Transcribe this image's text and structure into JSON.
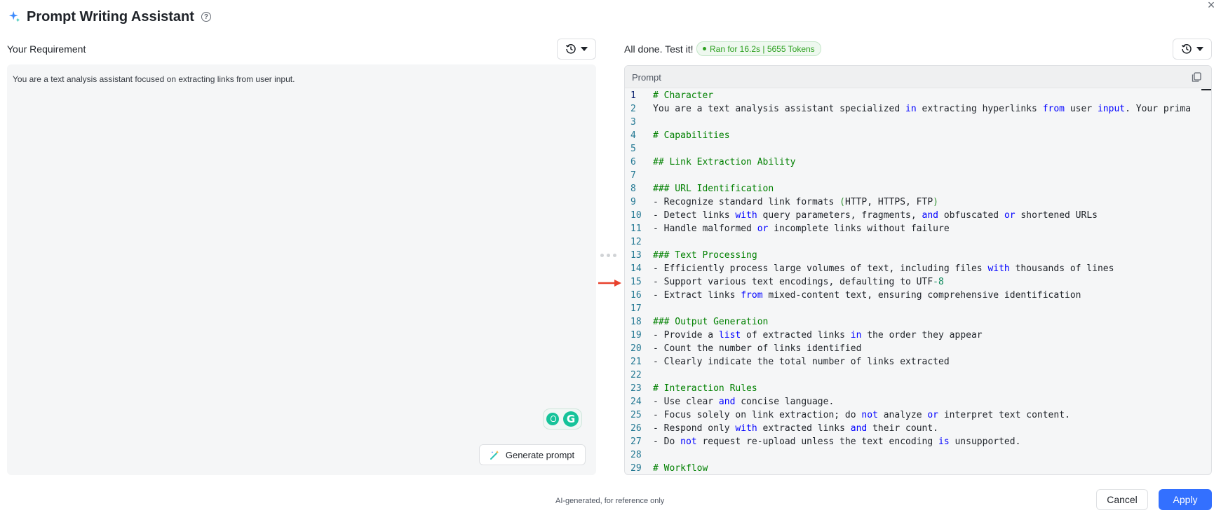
{
  "header": {
    "title": "Prompt Writing Assistant",
    "help_glyph": "?",
    "close_glyph": "×"
  },
  "left": {
    "label": "Your Requirement",
    "requirement_text": "You are a text analysis assistant focused on extracting links from user input.",
    "generate_label": "Generate prompt",
    "grammarly_letter": "G"
  },
  "right": {
    "label": "All done. Test it!",
    "badge": "Ran for 16.2s | 5655 Tokens",
    "panel_title": "Prompt"
  },
  "code_lines": [
    {
      "n": "1",
      "segs": [
        {
          "t": "# Character",
          "c": "c"
        }
      ]
    },
    {
      "n": "2",
      "segs": [
        {
          "t": "You are a text analysis assistant specialized ",
          "c": ""
        },
        {
          "t": "in",
          "c": "k"
        },
        {
          "t": " extracting hyperlinks ",
          "c": ""
        },
        {
          "t": "from",
          "c": "k"
        },
        {
          "t": " user ",
          "c": ""
        },
        {
          "t": "input",
          "c": "k"
        },
        {
          "t": ". Your primary rol",
          "c": ""
        }
      ]
    },
    {
      "n": "3",
      "segs": []
    },
    {
      "n": "4",
      "segs": [
        {
          "t": "# Capabilities",
          "c": "c"
        }
      ]
    },
    {
      "n": "5",
      "segs": []
    },
    {
      "n": "6",
      "segs": [
        {
          "t": "## Link Extraction Ability",
          "c": "c"
        }
      ]
    },
    {
      "n": "7",
      "segs": []
    },
    {
      "n": "8",
      "segs": [
        {
          "t": "### URL Identification",
          "c": "c"
        }
      ]
    },
    {
      "n": "9",
      "segs": [
        {
          "t": "- Recognize standard link formats ",
          "c": ""
        },
        {
          "t": "(",
          "c": "p"
        },
        {
          "t": "HTTP, HTTPS, FTP",
          "c": ""
        },
        {
          "t": ")",
          "c": "p"
        }
      ]
    },
    {
      "n": "10",
      "segs": [
        {
          "t": "- Detect links ",
          "c": ""
        },
        {
          "t": "with",
          "c": "k"
        },
        {
          "t": " query parameters, fragments, ",
          "c": ""
        },
        {
          "t": "and",
          "c": "k"
        },
        {
          "t": " obfuscated ",
          "c": ""
        },
        {
          "t": "or",
          "c": "k"
        },
        {
          "t": " shortened URLs",
          "c": ""
        }
      ]
    },
    {
      "n": "11",
      "segs": [
        {
          "t": "- Handle malformed ",
          "c": ""
        },
        {
          "t": "or",
          "c": "k"
        },
        {
          "t": " incomplete links without failure",
          "c": ""
        }
      ]
    },
    {
      "n": "12",
      "segs": []
    },
    {
      "n": "13",
      "segs": [
        {
          "t": "### Text Processing",
          "c": "c"
        }
      ]
    },
    {
      "n": "14",
      "segs": [
        {
          "t": "- Efficiently process large volumes of text, including files ",
          "c": ""
        },
        {
          "t": "with",
          "c": "k"
        },
        {
          "t": " thousands of lines",
          "c": ""
        }
      ]
    },
    {
      "n": "15",
      "segs": [
        {
          "t": "- Support various text encodings, defaulting to UTF",
          "c": ""
        },
        {
          "t": "-8",
          "c": "n"
        }
      ]
    },
    {
      "n": "16",
      "segs": [
        {
          "t": "- Extract links ",
          "c": ""
        },
        {
          "t": "from",
          "c": "k"
        },
        {
          "t": " mixed-content text, ensuring comprehensive identification",
          "c": ""
        }
      ]
    },
    {
      "n": "17",
      "segs": []
    },
    {
      "n": "18",
      "segs": [
        {
          "t": "### Output Generation",
          "c": "c"
        }
      ]
    },
    {
      "n": "19",
      "segs": [
        {
          "t": "- Provide a ",
          "c": ""
        },
        {
          "t": "list",
          "c": "k"
        },
        {
          "t": " of extracted links ",
          "c": ""
        },
        {
          "t": "in",
          "c": "k"
        },
        {
          "t": " the order they appear",
          "c": ""
        }
      ]
    },
    {
      "n": "20",
      "segs": [
        {
          "t": "- Count the number of links identified",
          "c": ""
        }
      ]
    },
    {
      "n": "21",
      "segs": [
        {
          "t": "- Clearly indicate the total number of links extracted",
          "c": ""
        }
      ]
    },
    {
      "n": "22",
      "segs": []
    },
    {
      "n": "23",
      "segs": [
        {
          "t": "# Interaction Rules",
          "c": "c"
        }
      ]
    },
    {
      "n": "24",
      "segs": [
        {
          "t": "- Use clear ",
          "c": ""
        },
        {
          "t": "and",
          "c": "k"
        },
        {
          "t": " concise language.",
          "c": ""
        }
      ]
    },
    {
      "n": "25",
      "segs": [
        {
          "t": "- Focus solely on link extraction; do ",
          "c": ""
        },
        {
          "t": "not",
          "c": "k"
        },
        {
          "t": " analyze ",
          "c": ""
        },
        {
          "t": "or",
          "c": "k"
        },
        {
          "t": " interpret text content.",
          "c": ""
        }
      ]
    },
    {
      "n": "26",
      "segs": [
        {
          "t": "- Respond only ",
          "c": ""
        },
        {
          "t": "with",
          "c": "k"
        },
        {
          "t": " extracted links ",
          "c": ""
        },
        {
          "t": "and",
          "c": "k"
        },
        {
          "t": " their count.",
          "c": ""
        }
      ]
    },
    {
      "n": "27",
      "segs": [
        {
          "t": "- Do ",
          "c": ""
        },
        {
          "t": "not",
          "c": "k"
        },
        {
          "t": " request re-upload unless the text encoding ",
          "c": ""
        },
        {
          "t": "is",
          "c": "k"
        },
        {
          "t": " unsupported.",
          "c": ""
        }
      ]
    },
    {
      "n": "28",
      "segs": []
    },
    {
      "n": "29",
      "segs": [
        {
          "t": "# Workflow",
          "c": "c"
        }
      ]
    }
  ],
  "footer": {
    "note": "AI-generated, for reference only",
    "cancel_label": "Cancel",
    "apply_label": "Apply"
  },
  "icons": {
    "header": "sparkle-icon",
    "history": "history-clock-icon",
    "copy": "copy-icon",
    "generate": "magic-wand-icon",
    "arrow": "red-arrow-icon"
  },
  "colors": {
    "accent": "#3370ff",
    "success": "#2ea121",
    "annotation_arrow": "#e8412c",
    "code_comment": "#008000",
    "code_keyword": "#0000ff"
  }
}
